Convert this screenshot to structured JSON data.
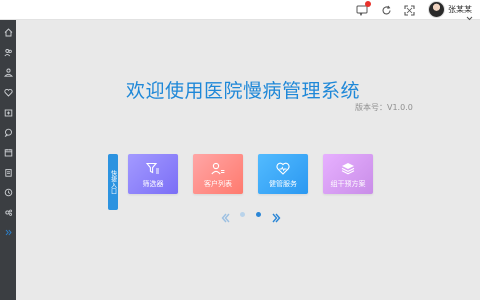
{
  "header": {
    "username": "张某某",
    "icons": [
      "message-icon",
      "refresh-icon",
      "fullscreen-icon",
      "chevron-down-icon"
    ]
  },
  "sidebar": {
    "items": [
      {
        "icon": "home-icon"
      },
      {
        "icon": "users-icon"
      },
      {
        "icon": "user-group-icon"
      },
      {
        "icon": "heart-monitor-icon"
      },
      {
        "icon": "hospital-icon"
      },
      {
        "icon": "chat-icon"
      },
      {
        "icon": "calendar-icon"
      },
      {
        "icon": "clipboard-icon"
      },
      {
        "icon": "clock-icon"
      },
      {
        "icon": "settings-icon"
      },
      {
        "icon": "chevrons-right-icon"
      }
    ]
  },
  "main": {
    "welcome": "欢迎使用医院慢病管理系统",
    "version": "版本号：V1.0.0",
    "quick_entry": "快捷入口",
    "cards": [
      {
        "label": "筛选器",
        "icon": "filter-icon",
        "color": "#8d82f8"
      },
      {
        "label": "客户列表",
        "icon": "user-list-icon",
        "color": "#ff8d86"
      },
      {
        "label": "健管服务",
        "icon": "heart-service-icon",
        "color": "#39a8f7"
      },
      {
        "label": "组干预方案",
        "icon": "layers-icon",
        "color": "#d8a0f2"
      }
    ],
    "pagination": {
      "pages": 2,
      "current": 2
    }
  },
  "colors": {
    "accent": "#1f88d8",
    "sidebar": "#3b3e42",
    "alert": "#e8312b"
  }
}
